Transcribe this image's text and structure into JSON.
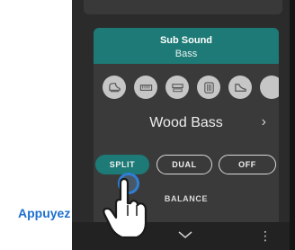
{
  "panel": {
    "title": "Sub Sound",
    "subtitle": "Bass",
    "icons": [
      "grand-piano-icon",
      "electric-piano-icon",
      "organ-icon",
      "strings-icon",
      "harpsichord-icon"
    ],
    "voice_name": "Wood Bass",
    "next_symbol": "›"
  },
  "modes": [
    {
      "label": "SPLIT",
      "active": true
    },
    {
      "label": "DUAL",
      "active": false
    },
    {
      "label": "OFF",
      "active": false
    }
  ],
  "balance_label": "BALANCE",
  "more_symbol": "⋮",
  "instruction": "Appuyez",
  "colors": {
    "accent": "#1d7a76",
    "panel": "#3a3a3a",
    "background": "#2b2b2b",
    "instruction": "#1e6fcf"
  }
}
